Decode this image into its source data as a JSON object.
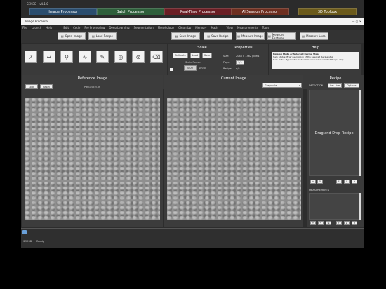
{
  "topbar": {
    "title": "SEM3D - v4.1.0",
    "modules": [
      {
        "label": "Image Processor",
        "color": "#2a4d6e"
      },
      {
        "label": "Batch Processor",
        "color": "#2e5f3b"
      },
      {
        "label": "Real-Time Processor",
        "color": "#6a1e24"
      },
      {
        "label": "AI Session Processor",
        "color": "#6e2f20"
      },
      {
        "label": "3D Toolbox",
        "color": "#6b5a1b"
      }
    ]
  },
  "window": {
    "title": "Image Processor",
    "menus": [
      "File",
      "Launch",
      "Help",
      "Edit",
      "Code",
      "Pre Processing",
      "Deep Learning",
      "Segmentation",
      "Morphology",
      "Clean Up",
      "Memory",
      "Math",
      "View",
      "Measurements",
      "Tools"
    ]
  },
  "toolbar": {
    "open_image": "Open Image",
    "load_recipe": "Load Recipe",
    "save_image": "Save Image",
    "save_recipe": "Save Recipe",
    "measure_image": "Measure Image",
    "measure_features": "Measure Features",
    "measure_local": "Measure Local"
  },
  "tools": [
    "pointer-icon",
    "line-measure-icon",
    "zoom-icon",
    "wave-icon",
    "pen-icon",
    "blob-icon",
    "region-icon",
    "eraser-icon"
  ],
  "scale": {
    "title": "Scale",
    "calibrate": "Calibrate",
    "load": "Load",
    "save": "Save",
    "scale_factor_label": "Scale Factor:",
    "value": "0.00",
    "unit": "µm/px"
  },
  "properties": {
    "title": "Properties",
    "size_label": "Size:",
    "size_value": "2048 x 1362 pixels",
    "page_label": "Page:",
    "page_value": "1/1",
    "recipe_label": "Recipe:",
    "recipe_value": "n/a"
  },
  "help": {
    "title": "Help",
    "line1": "Help on Mode or Selected Recipe Step",
    "line2": "Help Status:   Brief description of the selected Recipe step",
    "line3": "Help Notes:   Type notes and comments on the selected Recipe step"
  },
  "reference": {
    "title": "Reference Image",
    "load": "Load",
    "reset": "Reset",
    "file": "Part1.SEM.tif"
  },
  "current": {
    "title": "Current Image",
    "mode": "Grayscale"
  },
  "recipe": {
    "title": "Recipe",
    "detection": "DETECTION",
    "tab1": "Set Live",
    "tab2": "Options",
    "drop_hint": "Drag and Drop Recipe",
    "measurements": "MEASUREMENTS"
  },
  "status": {
    "label": "SEM3D",
    "text": "Ready"
  }
}
